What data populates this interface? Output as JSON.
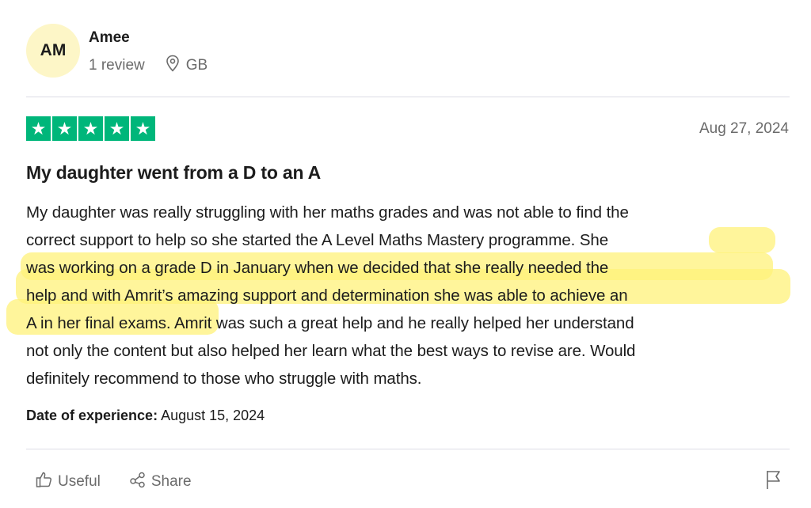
{
  "reviewer": {
    "initials": "AM",
    "name": "Amee",
    "reviews": "1 review",
    "country": "GB"
  },
  "review": {
    "rating": 5,
    "rating_color": "#00b67a",
    "date": "Aug 27, 2024",
    "title": "My daughter went from a D to an A",
    "body_lines": [
      "My daughter was really struggling with her maths grades and was not able to find the",
      "correct support to help so she started the A Level Maths Mastery programme. She",
      "was working on a grade D in January when we decided that she really needed the",
      "help and with Amrit’s amazing support and determination she was able to achieve an",
      "A in her final exams. Amrit was such a great help and he really helped her understand",
      "not only the content but also helped her learn what the best ways to revise are. Would",
      "definitely recommend to those who struggle with maths."
    ],
    "experience_label": "Date of experience:",
    "experience_date": "August 15, 2024"
  },
  "actions": {
    "useful": "Useful",
    "share": "Share"
  },
  "icons": {
    "location": "location-pin-icon",
    "thumb": "thumbs-up-icon",
    "share": "share-icon",
    "flag": "flag-icon",
    "star": "star-icon"
  },
  "highlight_color": "#fff27a"
}
